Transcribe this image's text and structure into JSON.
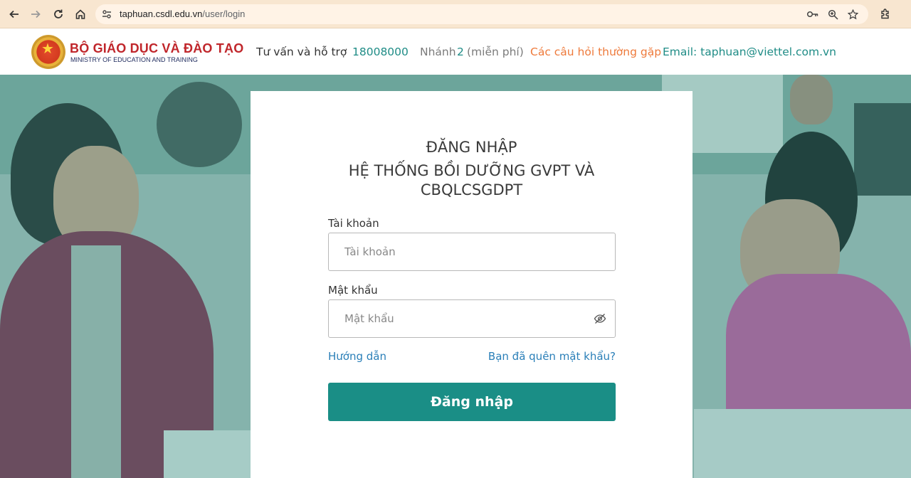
{
  "browser": {
    "url_host": "taphuan.csdl.edu.vn",
    "url_path": "/user/login",
    "icons": [
      "back-icon",
      "forward-icon",
      "reload-icon",
      "home-icon",
      "site-info-icon",
      "key-icon",
      "zoom-icon",
      "star-icon",
      "extensions-icon"
    ]
  },
  "header": {
    "org_title": "BỘ GIÁO DỤC VÀ ĐÀO TẠO",
    "org_subtitle": "MINISTRY OF EDUCATION AND TRAINING",
    "support_label": "Tư vấn và hỗ trợ",
    "hotline": "18008000",
    "branch_prefix": "Nhánh",
    "branch_number": "2",
    "branch_note": "(miễn phí)",
    "faq_link": "Các câu hỏi thường gặp",
    "email": "Email: taphuan@viettel.com.vn"
  },
  "login": {
    "title_line1": "ĐĂNG NHẬP",
    "title_line2": "HỆ THỐNG BỒI DƯỠNG GVPT VÀ",
    "title_line3": "CBQLCSGDPT",
    "account_label": "Tài khoản",
    "account_placeholder": "Tài khoản",
    "account_value": "",
    "password_label": "Mật khẩu",
    "password_placeholder": "Mật khẩu",
    "password_value": "",
    "guide_link": "Hướng dẫn",
    "forgot_link": "Bạn đã quên mật khẩu?",
    "submit_label": "Đăng nhập"
  },
  "colors": {
    "primary": "#1a8e86",
    "brand_red": "#c0262b",
    "link_blue": "#2a7fb8",
    "faq_orange": "#ee7a3b"
  }
}
